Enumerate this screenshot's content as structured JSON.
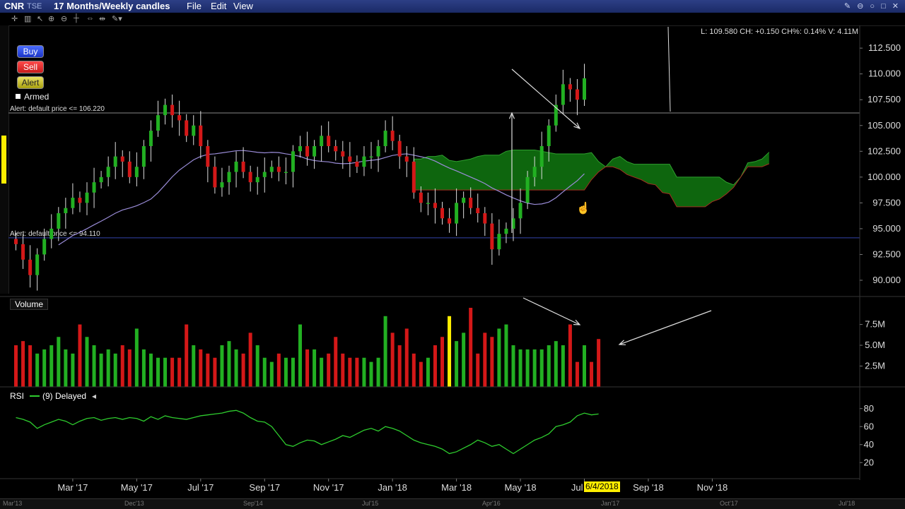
{
  "toolbar": {
    "symbol": "CNR",
    "exchange": "TSE",
    "period": "17 Months/Weekly candles",
    "menu": [
      "File",
      "Edit",
      "View"
    ]
  },
  "order_buttons": {
    "buy": "Buy",
    "sell": "Sell",
    "alert": "Alert",
    "armed": "Armed"
  },
  "alerts": {
    "upper": "Alert: default price <= 106.220",
    "lower": "Alert: default price <= 94.110"
  },
  "info_text": "L: 109.580 CH: +0.150 CH%: 0.14% V: 4.11M",
  "volume_label": "Volume",
  "rsi": {
    "label": "RSI",
    "params": "(9) Delayed"
  },
  "date_badge": "6/4/2018",
  "overview_labels": [
    "Mar'13",
    "Dec'13",
    "Sep'14",
    "Jul'15",
    "Apr'16",
    "Jan'17",
    "Oct'17",
    "Jul'18"
  ],
  "colors": {
    "up": "#22b022",
    "down": "#d41818",
    "cloud_green": "#0f6b0f",
    "cloud_red": "#5a0a0a",
    "ma": "#9a8cd8",
    "rsi": "#2ecc2e",
    "highlight": "#ffee00"
  },
  "chart_data": {
    "type": "candlestick",
    "title": "CNR TSE 17 Months/Weekly candles",
    "price_axis": {
      "ticks": [
        "112.500",
        "110.000",
        "107.500",
        "105.000",
        "102.500",
        "100.000",
        "97.500",
        "95.000",
        "92.500",
        "90.000"
      ],
      "range": [
        88.7,
        114.7
      ]
    },
    "x_ticks": [
      "Mar '17",
      "May '17",
      "Jul '17",
      "Sep '17",
      "Nov '17",
      "Jan '18",
      "Mar '18",
      "May '18",
      "Jul '18",
      "Sep '18",
      "Nov '18"
    ],
    "x_tick_weeks": [
      8,
      17,
      26,
      35,
      44,
      53,
      62,
      71,
      80,
      89,
      98
    ],
    "alert_lines": [
      106.22,
      94.11
    ],
    "closes": [
      93.5,
      92.0,
      90.5,
      92.5,
      94.0,
      95.0,
      96.5,
      97.0,
      98.0,
      97.5,
      98.5,
      99.5,
      100.0,
      101.0,
      102.0,
      101.5,
      100.0,
      101.0,
      103.0,
      104.5,
      106.0,
      107.0,
      106.0,
      105.5,
      104.0,
      105.0,
      103.0,
      101.0,
      99.0,
      99.5,
      100.5,
      101.5,
      100.5,
      99.5,
      100.0,
      100.5,
      101.0,
      100.5,
      100.5,
      102.5,
      103.0,
      102.0,
      103.0,
      104.0,
      103.0,
      102.5,
      102.0,
      101.5,
      101.0,
      102.0,
      102.0,
      103.0,
      104.5,
      103.5,
      102.0,
      101.5,
      98.5,
      97.5,
      97.5,
      97.0,
      96.0,
      95.5,
      97.5,
      98.0,
      97.0,
      96.5,
      95.5,
      93.0,
      94.5,
      95.0,
      96.0,
      97.5,
      100.0,
      101.0,
      103.0,
      105.0,
      107.0,
      109.0,
      108.5,
      107.5,
      109.58
    ],
    "volume_axis": {
      "ticks": [
        "7.5M",
        "5.0M",
        "2.5M"
      ],
      "max": 9.5
    },
    "volumes": [
      5.0,
      5.5,
      5.0,
      4.0,
      4.5,
      5.0,
      6.0,
      4.5,
      4.0,
      7.5,
      6.0,
      5.0,
      4.0,
      4.5,
      4.0,
      5.0,
      4.5,
      7.0,
      4.5,
      4.0,
      3.5,
      3.5,
      3.5,
      3.5,
      7.5,
      5.0,
      4.5,
      4.0,
      3.5,
      5.0,
      5.5,
      4.5,
      4.0,
      6.5,
      5.0,
      3.5,
      3.0,
      4.0,
      3.5,
      3.5,
      7.5,
      4.5,
      4.5,
      3.5,
      4.0,
      6.0,
      4.0,
      3.5,
      3.5,
      3.5,
      3.0,
      3.5,
      8.5,
      6.5,
      5.0,
      7.0,
      4.0,
      3.0,
      3.5,
      5.0,
      6.0,
      8.5,
      5.5,
      6.5,
      9.5,
      4.0,
      6.5,
      6.0,
      7.0,
      7.5,
      5.0,
      4.5,
      4.5,
      4.5,
      4.5,
      5.0,
      5.5,
      5.0,
      7.5,
      3.0,
      5.0,
      3.0,
      5.75
    ],
    "rsi": {
      "ticks": [
        "80",
        "60",
        "40",
        "20"
      ],
      "range": [
        10,
        90
      ],
      "period": 9,
      "values": [
        70,
        68,
        65,
        58,
        62,
        65,
        68,
        66,
        62,
        66,
        69,
        70,
        67,
        69,
        70,
        68,
        70,
        69,
        66,
        71,
        68,
        72,
        70,
        69,
        68,
        70,
        72,
        73,
        74,
        75,
        77,
        78,
        75,
        70,
        66,
        65,
        60,
        50,
        40,
        38,
        42,
        45,
        44,
        40,
        43,
        46,
        50,
        48,
        52,
        56,
        58,
        55,
        60,
        58,
        55,
        50,
        45,
        42,
        40,
        38,
        35,
        30,
        32,
        36,
        40,
        45,
        42,
        38,
        40,
        35,
        30,
        35,
        40,
        45,
        48,
        52,
        60,
        62,
        65,
        72,
        75,
        73,
        74
      ],
      "series_name": ""
    },
    "ichimoku_cloud": {
      "note_free": true
    },
    "ma_line": true,
    "grid": false
  }
}
